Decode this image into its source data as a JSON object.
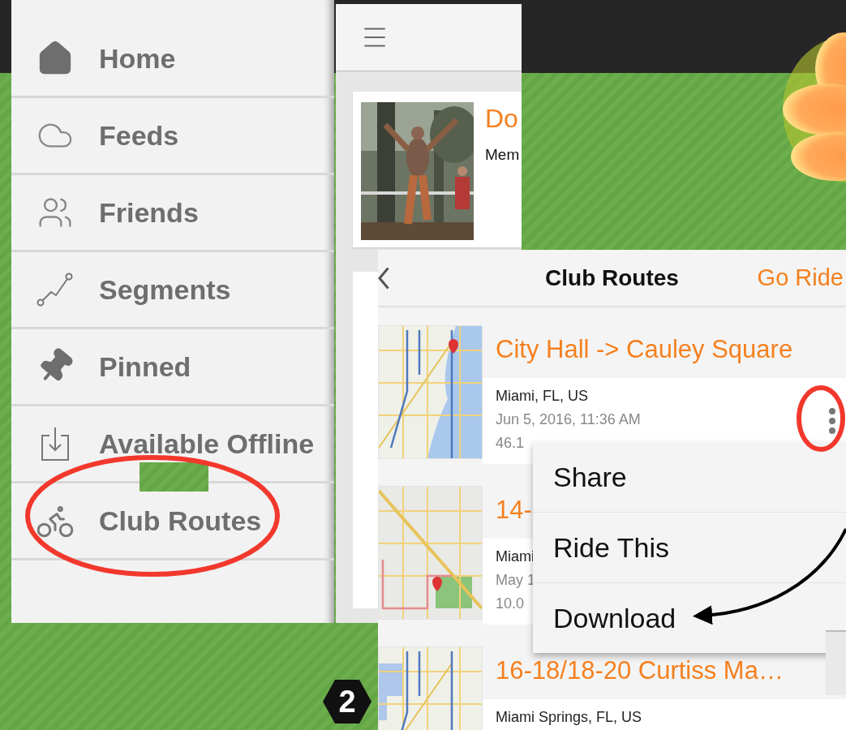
{
  "sidebar": {
    "items": [
      {
        "label": "Home",
        "kind": "home"
      },
      {
        "label": "Feeds",
        "kind": "cloud"
      },
      {
        "label": "Friends",
        "kind": "friends"
      },
      {
        "label": "Segments",
        "kind": "segments"
      },
      {
        "label": "Pinned",
        "kind": "pin"
      },
      {
        "label": "Available Offline",
        "kind": "offline"
      },
      {
        "label": "Club Routes",
        "kind": "bike"
      }
    ]
  },
  "feed": {
    "card": {
      "kind": "picture",
      "title": "Do",
      "subtitle": "Mem"
    }
  },
  "club_routes": {
    "title": "Club Routes",
    "action": "Go Ride",
    "routes": [
      {
        "kind": "picture",
        "title": "City Hall -> Cauley Square",
        "location": "Miami, FL, US",
        "date": "Jun 5, 2016, 11:36 AM",
        "distance": "46.1"
      },
      {
        "kind": "picture",
        "title": "14-",
        "location": "Miami",
        "date": "May 1",
        "distance": "10.0"
      },
      {
        "kind": "picture",
        "title": "16-18/18-20 Curtiss Ma…",
        "location": "Miami Springs, FL, US"
      }
    ]
  },
  "context_menu": {
    "items": [
      "Share",
      "Ride This",
      "Download"
    ]
  },
  "step_badge": "2"
}
